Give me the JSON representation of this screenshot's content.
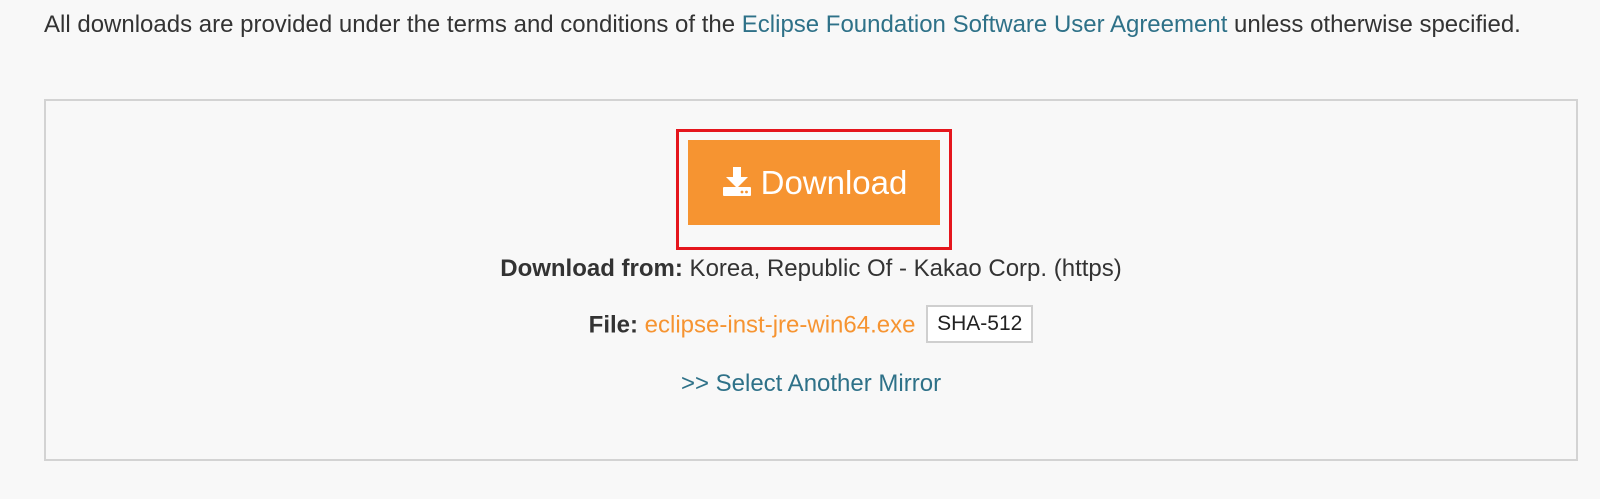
{
  "terms": {
    "prefix": "All downloads are provided under the terms and conditions of the ",
    "link_label": "Eclipse Foundation Software User Agreement",
    "suffix": " unless otherwise specified."
  },
  "download": {
    "button_label": "Download",
    "icon": "download-icon",
    "from_label": "Download from:",
    "from_value": " Korea, Republic Of - Kakao Corp. (https)",
    "file_label": "File:",
    "file_name": "eclipse-inst-jre-win64.exe",
    "checksum_label": "SHA-512",
    "mirror_link": ">> Select Another Mirror"
  },
  "colors": {
    "accent_orange": "#f69431",
    "link_blue": "#2e7188",
    "highlight_red": "#e5161d",
    "background": "#f8f8f8"
  }
}
